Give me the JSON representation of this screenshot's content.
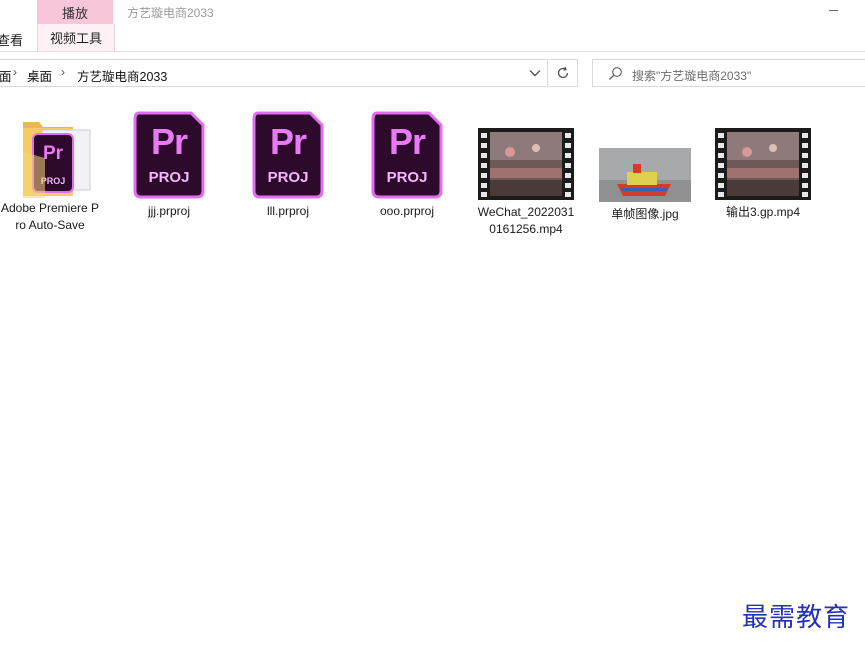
{
  "ribbon": {
    "tab_play": "播放",
    "tab_view": "查看",
    "tab_video_tools": "视频工具",
    "window_title": "方艺璇电商2033"
  },
  "address_bar": {
    "crumb_root": "面",
    "crumb_desktop": "桌面",
    "crumb_folder": "方艺璇电商2033"
  },
  "search": {
    "placeholder": "搜索\"方艺璇电商2033\""
  },
  "files": {
    "adobe_folder": {
      "label": "Adobe Premiere Pro Auto-Save",
      "icon": "folder-premiere-icon"
    },
    "jjj": {
      "label": "jjj.prproj",
      "icon": "premiere-project-icon"
    },
    "lll": {
      "label": "lll.prproj",
      "icon": "premiere-project-icon"
    },
    "ooo": {
      "label": "ooo.prproj",
      "icon": "premiere-project-icon"
    },
    "wechat": {
      "label": "WeChat_20220310161256.mp4",
      "icon": "video-thumbnail-icon"
    },
    "single_frame": {
      "label": "单帧图像.jpg",
      "icon": "image-thumbnail-icon"
    },
    "output3": {
      "label": "输出3.gp.mp4",
      "icon": "video-thumbnail-icon"
    }
  },
  "pr_icon": {
    "pr": "Pr",
    "proj": "PROJ"
  },
  "watermark": "最需教育",
  "colors": {
    "ribbon_tab_active": "#f7c6da",
    "premiere_bg": "#2d0a2b",
    "premiere_border": "#e36cf3",
    "watermark": "#2430b8"
  }
}
